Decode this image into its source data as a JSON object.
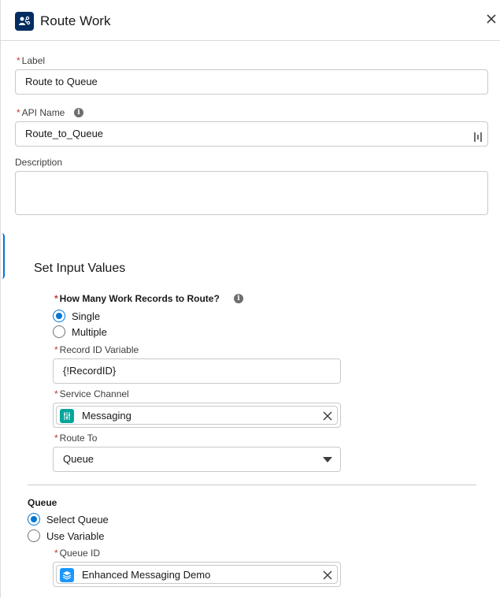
{
  "header": {
    "title": "Route Work",
    "icon": "route-work-icon"
  },
  "label_field": {
    "label": "Label",
    "value": "Route to Queue"
  },
  "api_name_field": {
    "label": "API Name",
    "value": "Route_to_Queue"
  },
  "description_field": {
    "label": "Description",
    "value": ""
  },
  "set_input_values": {
    "title": "Set Input Values",
    "how_many": {
      "label": "How Many Work Records to Route?",
      "options": [
        "Single",
        "Multiple"
      ],
      "selected": "Single"
    },
    "record_id": {
      "label": "Record ID Variable",
      "value": "{!RecordID}"
    },
    "service_channel": {
      "label": "Service Channel",
      "value": "Messaging",
      "icon_color": "#06a59a"
    },
    "route_to": {
      "label": "Route To",
      "value": "Queue"
    }
  },
  "queue": {
    "title": "Queue",
    "options": [
      "Select Queue",
      "Use Variable"
    ],
    "selected": "Select Queue",
    "queue_id": {
      "label": "Queue ID",
      "value": "Enhanced Messaging Demo",
      "icon_color": "#1b96ff"
    }
  },
  "colors": {
    "brand": "#0176d3",
    "required": "#c23934",
    "header_icon_bg": "#032d60"
  }
}
